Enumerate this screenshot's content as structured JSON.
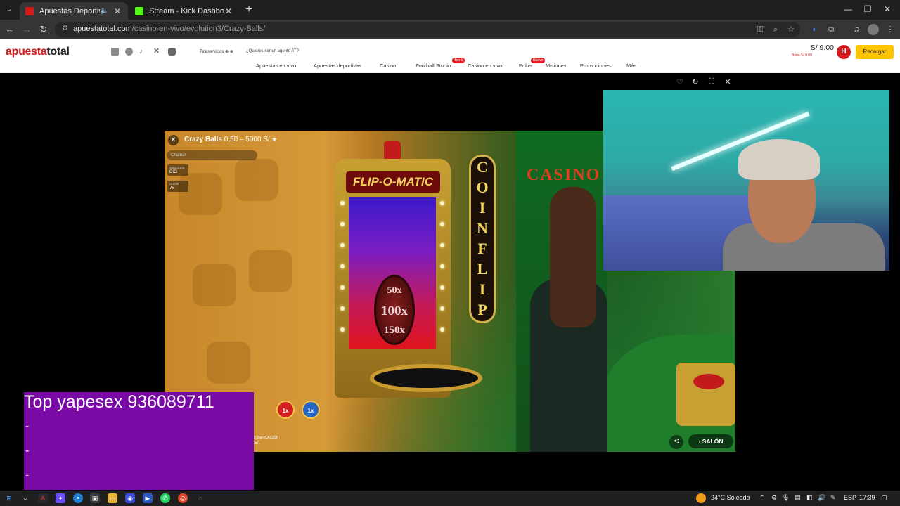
{
  "browser": {
    "tabs": [
      {
        "title": "Apuestas Deportivas Onlin",
        "active": true,
        "favicon_color": "#d11a1a"
      },
      {
        "title": "Stream - Kick Dashboard",
        "active": false,
        "favicon_color": "#53fc18"
      }
    ],
    "new_tab_icon": "plus-icon",
    "url_host": "apuestatotal.com",
    "url_path": "/casino-en-vivo/evolution3/Crazy-Balls/"
  },
  "site": {
    "logo_red": "apuesta",
    "logo_dark": "total",
    "support_text": "Teleservicios",
    "agent_text": "¿Quieres ser un agente AT?",
    "nav": [
      "Apuestas en vivo",
      "Apuestas deportivas",
      "Casino",
      "Football Studio",
      "Casino en vivo",
      "Poker",
      "Misiones",
      "Promociones",
      "Más"
    ],
    "badges": {
      "football": "Top 1",
      "poker": "Nuevo"
    },
    "balance": "S/ 9.00",
    "bonus": "Bono S/ 0.00",
    "avatar_letter": "H",
    "recharge_label": "Recargar",
    "brand_color": "#d11a1a",
    "accent_color": "#ffc400"
  },
  "game": {
    "title": "Crazy Balls",
    "range": "0,50 – 5000 S/.",
    "chat_placeholder": "Chatear",
    "stats": [
      {
        "label": "Saldo0100",
        "value": "BIG"
      },
      {
        "label": "Crecer",
        "value": "7x"
      }
    ],
    "machine_banner": "FLIP-O-MATIC",
    "coin_values": [
      "50x",
      "100x",
      "150x"
    ],
    "sign_letters": [
      "C",
      "O",
      "I",
      "N",
      "F",
      "L",
      "I",
      "P"
    ],
    "casino_sign": "CASINO",
    "chips": [
      "1x",
      "1x"
    ],
    "bonus_label": "BONIFICACIÓN",
    "bonus_sub": "S/.",
    "salon_label": "SALÓN"
  },
  "overlay": {
    "promo_text": "Top yapesex 936089711",
    "dashes": [
      "-",
      "-",
      "-"
    ],
    "bg_color": "#7a0aa6"
  },
  "taskbar": {
    "weather": "24°C  Soleado",
    "lang": "ESP",
    "time": "17:39"
  }
}
